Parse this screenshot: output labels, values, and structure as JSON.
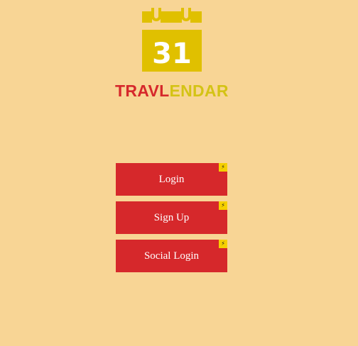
{
  "logo": {
    "icon": "calendar-icon",
    "day_number": "31",
    "color": "#e0c000",
    "brand_part1": "TRAVL",
    "brand_part2": "ENDAR",
    "brand_part1_color": "#d6282b",
    "brand_part2_color": "#d4c315"
  },
  "buttons": {
    "login_label": "Login",
    "signup_label": "Sign Up",
    "social_login_label": "Social Login",
    "color": "#d6282b",
    "badge_icon": "lightning-icon",
    "badge_glyph": "⚡",
    "badge_color": "#f5d000"
  },
  "background_color": "#f8d595"
}
